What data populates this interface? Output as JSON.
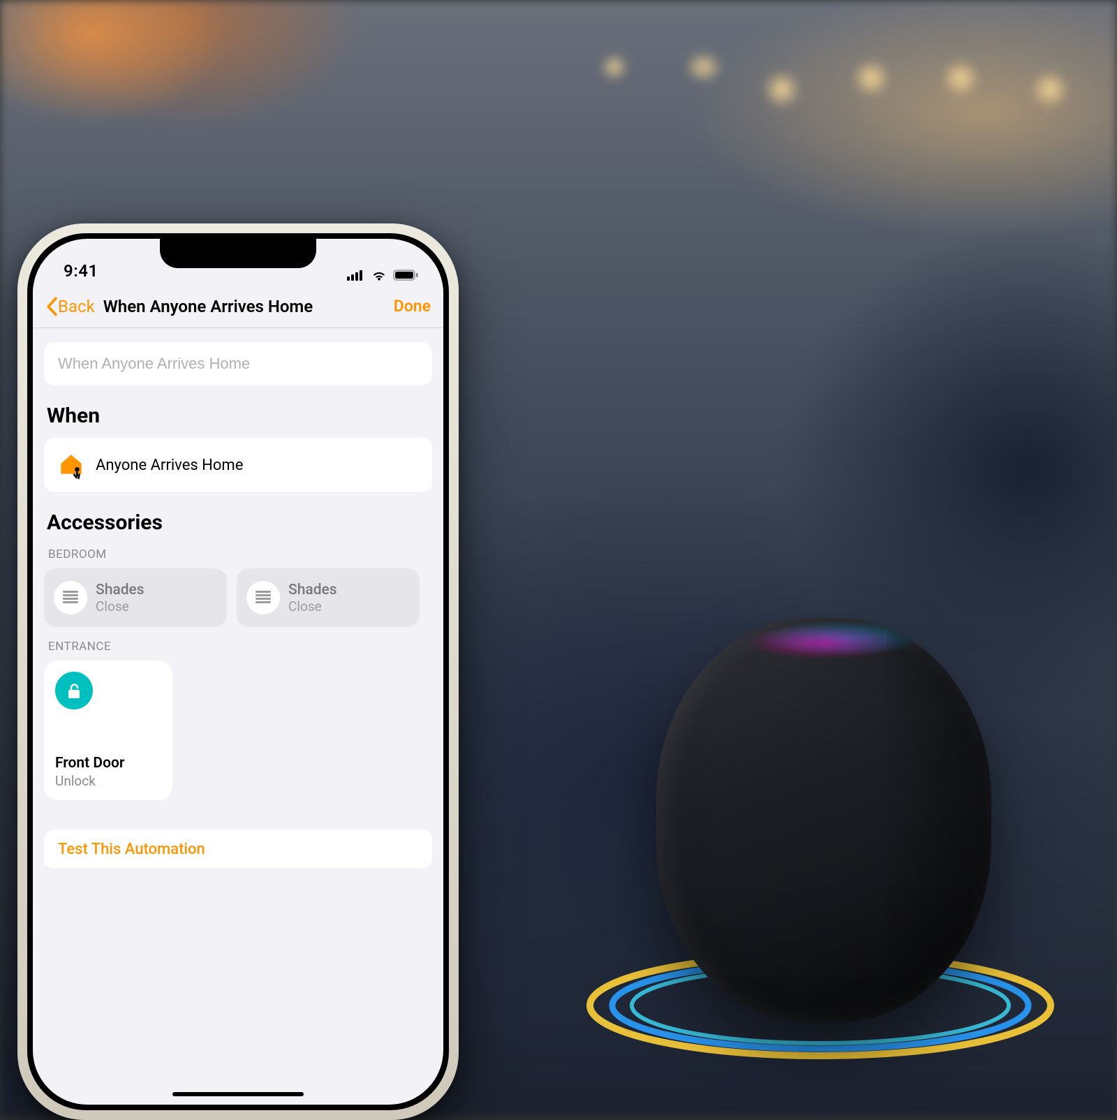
{
  "status": {
    "time": "9:41"
  },
  "nav": {
    "back": "Back",
    "title": "When Anyone Arrives Home",
    "done": "Done"
  },
  "automation_name_placeholder": "When Anyone Arrives Home",
  "sections": {
    "when_title": "When",
    "when_trigger": "Anyone Arrives Home",
    "accessories_title": "Accessories",
    "groups": {
      "bedroom": {
        "label": "BEDROOM",
        "tiles": [
          {
            "name": "Shades",
            "state": "Close"
          },
          {
            "name": "Shades",
            "state": "Close"
          }
        ]
      },
      "entrance": {
        "label": "ENTRANCE",
        "tiles": [
          {
            "name": "Front Door",
            "state": "Unlock"
          }
        ]
      }
    }
  },
  "test_button": "Test This Automation",
  "colors": {
    "accent": "#ff9500",
    "teal": "#00bfbf"
  }
}
